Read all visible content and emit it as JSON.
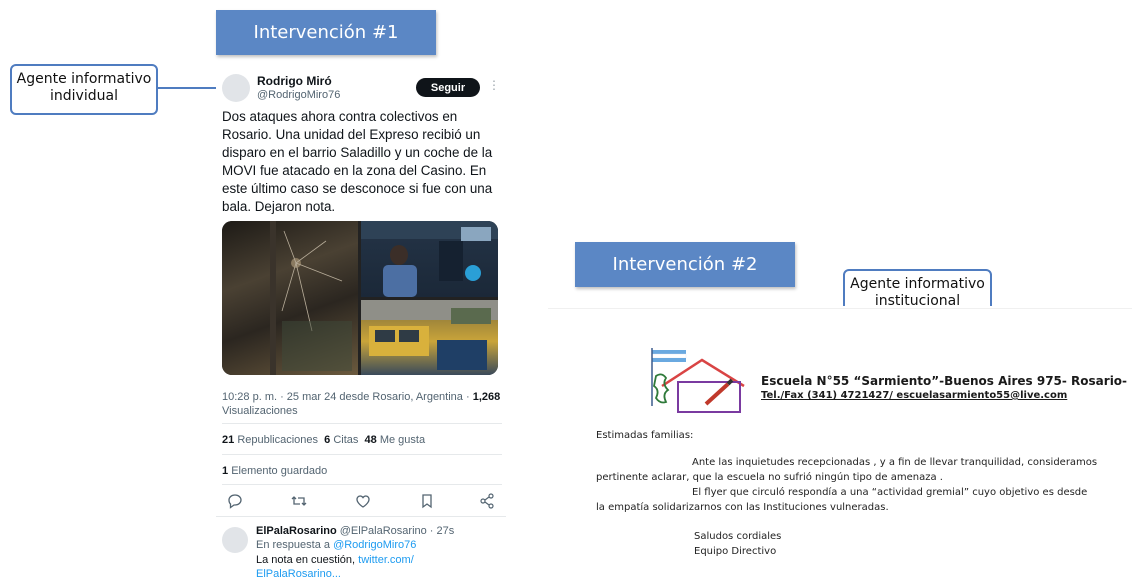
{
  "intervention1": {
    "label": "Intervención #1"
  },
  "intervention2": {
    "label": "Intervención #2"
  },
  "callout_individual": {
    "line1": "Agente informativo",
    "line2": "individual"
  },
  "callout_institutional": {
    "line1": "Agente informativo",
    "line2": "institucional"
  },
  "tweet": {
    "author_name": "Rodrigo Miró",
    "author_handle": "@RodrigoMiro76",
    "follow_label": "Seguir",
    "more_glyph": "⋮",
    "text_lines": [
      "Dos ataques ahora contra colectivos en",
      "Rosario. Una unidad del Expreso recibió un",
      "disparo en el barrio Saladillo y un coche de la",
      "MOVI fue atacado en la zona del Casino. En",
      "este último caso se desconoce si fue con una",
      "bala. Dejaron nota."
    ],
    "timestamp": "10:28 p. m. · 25 mar 24 desde Rosario, Argentina ·",
    "views_count": "1,268",
    "views_label": "Visualizaciones",
    "reposts_count": "21",
    "reposts_label": "Republicaciones",
    "quotes_count": "6",
    "quotes_label": "Citas",
    "likes_count": "48",
    "likes_label": "Me gusta",
    "saved_count": "1",
    "saved_label": "Elemento guardado",
    "actions": [
      "reply-icon",
      "repost-icon",
      "like-icon",
      "bookmark-icon",
      "share-icon"
    ]
  },
  "reply": {
    "name": "ElPalaRosarino",
    "handle_time": "@ElPalaRosarino · 27s",
    "in_reply_prefix": "En respuesta a",
    "in_reply_handle": "@RodrigoMiro76",
    "text": "La nota en cuestión,",
    "link_part1": "twitter.com/",
    "link_part2": "ElPalaRosarino..."
  },
  "letter": {
    "school_name": "Escuela N°55 “Sarmiento”-Buenos Aires 975- Rosario-",
    "school_contact": "Tel./Fax (341) 4721427/ escuelasarmiento55@live.com",
    "greeting": "Estimadas familias:",
    "p1_line1": "Ante las inquietudes recepcionadas , y a fin de llevar tranquilidad, consideramos",
    "p1_line2": "pertinente aclarar, que la escuela no sufrió ningún tipo de amenaza .",
    "p2_line1": "El flyer que circuló respondía a una “actividad gremial” cuyo objetivo es desde",
    "p2_line2": "la empatía solidarizarnos con las Instituciones vulneradas.",
    "closing1": "Saludos cordiales",
    "closing2": "Equipo Directivo"
  },
  "colors": {
    "banner": "#5b87c5",
    "callout_border": "#4f7cc0",
    "link": "#1d9bf0"
  }
}
